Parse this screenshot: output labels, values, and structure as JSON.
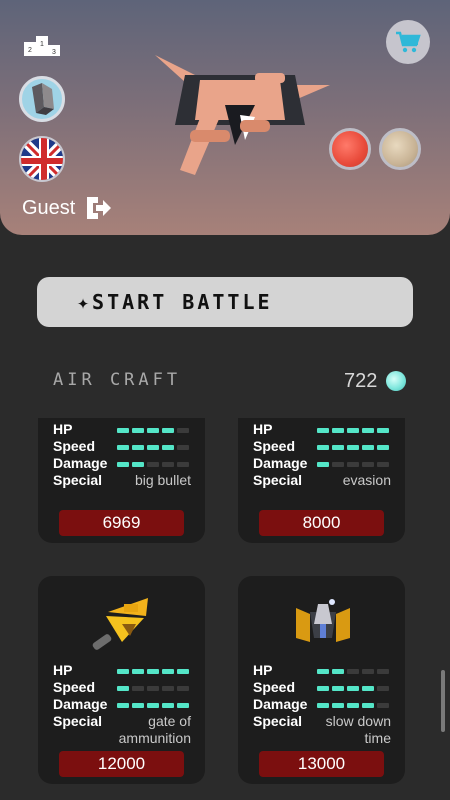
{
  "header": {
    "user_name": "Guest",
    "icons": [
      "podium-icon",
      "avatar",
      "uk-flag-icon",
      "logout-icon",
      "shopping-cart-icon"
    ],
    "color_options": [
      "#e84a3a",
      "#c9b496"
    ]
  },
  "main": {
    "start_label": "✦START BATTLE",
    "section_title": "AIR CRAFT",
    "gem_count": "722"
  },
  "stat_labels": {
    "hp": "HP",
    "speed": "Speed",
    "damage": "Damage",
    "special": "Special"
  },
  "aircraft": [
    {
      "hp": 4,
      "speed": 4,
      "damage": 2,
      "special": "big bullet",
      "price": "6969"
    },
    {
      "hp": 5,
      "speed": 5,
      "damage": 1,
      "special": "evasion",
      "price": "8000"
    },
    {
      "hp": 5,
      "speed": 1,
      "damage": 5,
      "special": "gate of ammunition",
      "price": "12000"
    },
    {
      "hp": 2,
      "speed": 4,
      "damage": 4,
      "special": "slow down time",
      "price": "13000"
    }
  ],
  "colors": {
    "accent": "#54e6c8",
    "price_bg": "#7b0f0f",
    "card_bg": "#1d1d1d"
  }
}
